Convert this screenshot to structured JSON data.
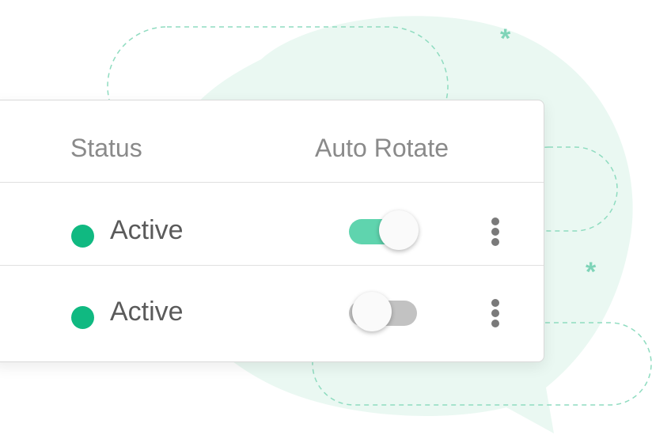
{
  "table": {
    "headers": {
      "status": "Status",
      "auto_rotate": "Auto Rotate"
    },
    "rows": [
      {
        "status": "Active",
        "status_color": "#10b981",
        "auto_rotate": true
      },
      {
        "status": "Active",
        "status_color": "#10b981",
        "auto_rotate": false
      }
    ]
  },
  "colors": {
    "accent": "#10b981",
    "toggle_on": "#5fd4ae",
    "toggle_off": "#c2c2c2",
    "background_blob": "#eaf8f2",
    "dashed_outline": "#8fdcc0"
  },
  "icons": {
    "row_menu": "more-vertical-icon",
    "decoration": "asterisk-icon"
  }
}
